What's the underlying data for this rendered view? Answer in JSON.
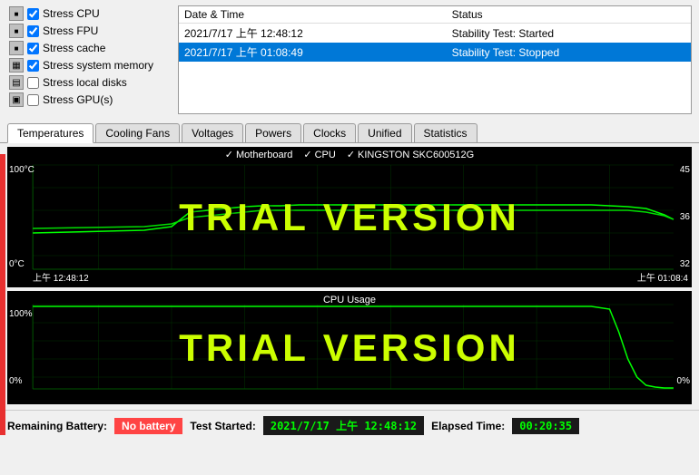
{
  "stress_tests": [
    {
      "id": "cpu",
      "label": "Stress CPU",
      "checked": true
    },
    {
      "id": "fpu",
      "label": "Stress FPU",
      "checked": true
    },
    {
      "id": "cache",
      "label": "Stress cache",
      "checked": true
    },
    {
      "id": "memory",
      "label": "Stress system memory",
      "checked": true
    },
    {
      "id": "disks",
      "label": "Stress local disks",
      "checked": false
    },
    {
      "id": "gpus",
      "label": "Stress GPU(s)",
      "checked": false
    }
  ],
  "log": {
    "headers": [
      "Date & Time",
      "Status"
    ],
    "rows": [
      {
        "datetime": "2021/7/17 上午 12:48:12",
        "status": "Stability Test: Started",
        "selected": false
      },
      {
        "datetime": "2021/7/17 上午 01:08:49",
        "status": "Stability Test: Stopped",
        "selected": true
      }
    ]
  },
  "tabs": [
    {
      "id": "temperatures",
      "label": "Temperatures",
      "active": true
    },
    {
      "id": "cooling-fans",
      "label": "Cooling Fans",
      "active": false
    },
    {
      "id": "voltages",
      "label": "Voltages",
      "active": false
    },
    {
      "id": "powers",
      "label": "Powers",
      "active": false
    },
    {
      "id": "clocks",
      "label": "Clocks",
      "active": false
    },
    {
      "id": "unified",
      "label": "Unified",
      "active": false
    },
    {
      "id": "statistics",
      "label": "Statistics",
      "active": false
    }
  ],
  "temp_chart": {
    "title": "",
    "legend": [
      {
        "label": "Motherboard",
        "checked": true
      },
      {
        "label": "CPU",
        "checked": true
      },
      {
        "label": "KINGSTON SKC600512G",
        "checked": true
      }
    ],
    "y_top": "100°C",
    "y_bottom": "0°C",
    "y_right_top": "45",
    "y_right_mid": "36",
    "y_right_low": "32",
    "x_left": "上午 12:48:12",
    "x_right": "上午 01:08:4",
    "trial_text": "TRIAL VERSION"
  },
  "usage_chart": {
    "title": "CPU Usage",
    "y_top": "100%",
    "y_bottom": "0%",
    "y_right": "0%",
    "x_left": "",
    "trial_text": "TRIAL VERSION"
  },
  "status_bar": {
    "battery_label": "Remaining Battery:",
    "battery_value": "No battery",
    "test_started_label": "Test Started:",
    "test_started_value": "2021/7/17 上午 12:48:12",
    "elapsed_label": "Elapsed Time:",
    "elapsed_value": "00:20:35"
  }
}
